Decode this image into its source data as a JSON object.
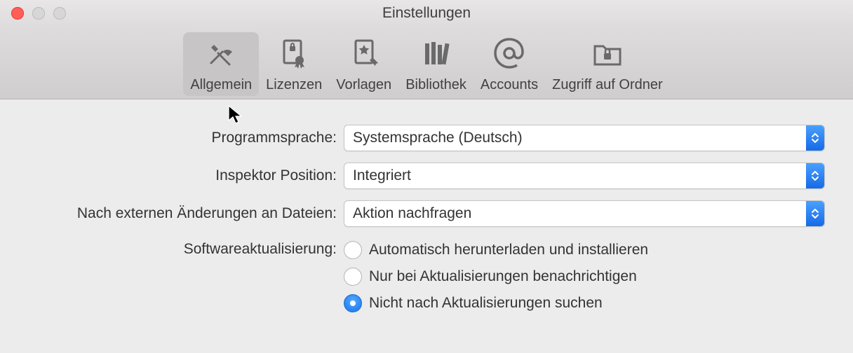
{
  "window": {
    "title": "Einstellungen"
  },
  "toolbar": {
    "items": [
      {
        "label": "Allgemein"
      },
      {
        "label": "Lizenzen"
      },
      {
        "label": "Vorlagen"
      },
      {
        "label": "Bibliothek"
      },
      {
        "label": "Accounts"
      },
      {
        "label": "Zugriff auf Ordner"
      }
    ]
  },
  "form": {
    "language": {
      "label": "Programmsprache:",
      "value": "Systemsprache (Deutsch)"
    },
    "inspector": {
      "label": "Inspektor Position:",
      "value": "Integriert"
    },
    "external_changes": {
      "label": "Nach externen Änderungen an Dateien:",
      "value": "Aktion nachfragen"
    },
    "update": {
      "label": "Softwareaktualisierung:",
      "options": [
        "Automatisch herunterladen und installieren",
        "Nur bei Aktualisierungen benachrichtigen",
        "Nicht nach Aktualisierungen suchen"
      ],
      "selected_index": 2
    }
  }
}
